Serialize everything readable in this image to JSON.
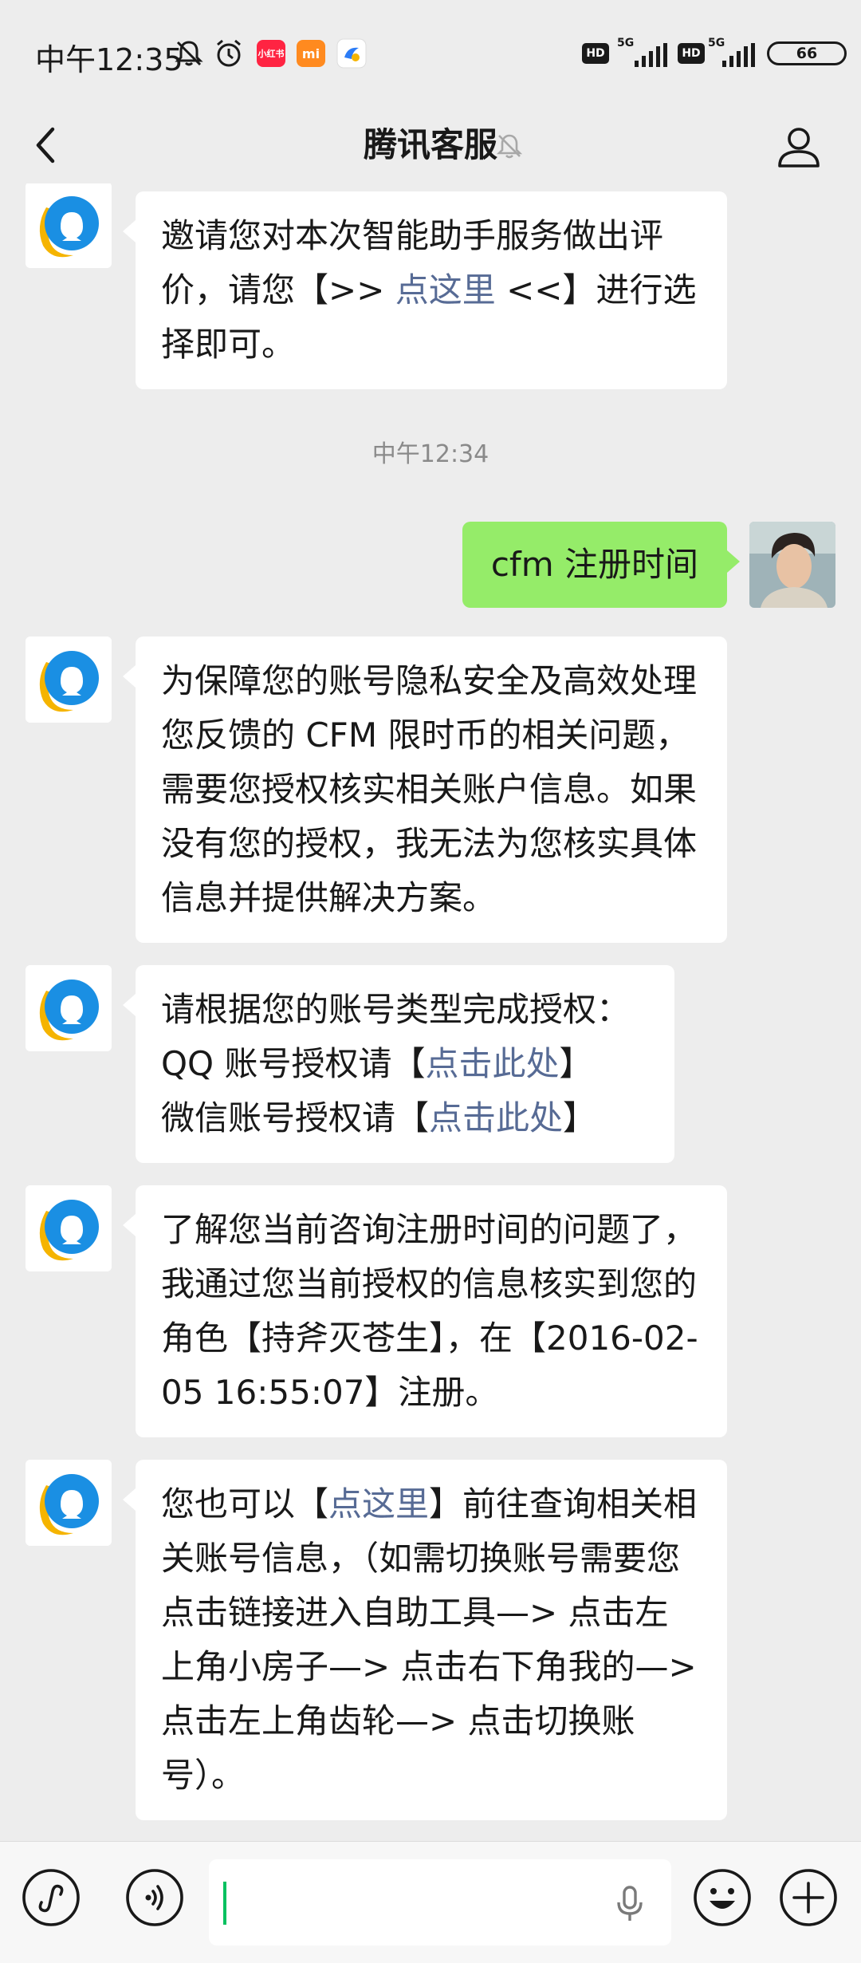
{
  "status_bar": {
    "time": "中午12:35",
    "app1": "小红书",
    "app2": "mi",
    "hd": "HD",
    "net1": "5G",
    "net2": "5G",
    "battery": "66"
  },
  "header": {
    "title": "腾讯客服"
  },
  "messages": [
    {
      "sender": "bot",
      "parts": [
        {
          "t": "邀请您对本次智能助手服务做出评价，请您【>> "
        },
        {
          "t": "点这里",
          "link": true
        },
        {
          "t": " <<】进行选择即可。"
        }
      ]
    },
    {
      "timestamp": "中午12:34"
    },
    {
      "sender": "user",
      "text": "cfm 注册时间"
    },
    {
      "sender": "bot",
      "parts": [
        {
          "t": "为保障您的账号隐私安全及高效处理您反馈的 CFM 限时币的相关问题，需要您授权核实相关账户信息。如果没有您的授权，我无法为您核实具体信息并提供解决方案。"
        }
      ]
    },
    {
      "sender": "bot",
      "lines": [
        [
          {
            "t": "请根据您的账号类型完成授权："
          }
        ],
        [
          {
            "t": "QQ 账号授权请【"
          },
          {
            "t": "点击此处",
            "link": true
          },
          {
            "t": "】"
          }
        ],
        [
          {
            "t": "微信账号授权请【"
          },
          {
            "t": "点击此处",
            "link": true
          },
          {
            "t": "】"
          }
        ]
      ]
    },
    {
      "sender": "bot",
      "parts": [
        {
          "t": "了解您当前咨询注册时间的问题了，我通过您当前授权的信息核实到您的角色【持斧灭苍生】，在【2016-02-05 16:55:07】注册。"
        }
      ]
    },
    {
      "sender": "bot",
      "parts": [
        {
          "t": "您也可以【"
        },
        {
          "t": "点这里",
          "link": true
        },
        {
          "t": "】前往查询相关相关账号信息，（如需切换账号需要您点击链接进入自助工具—> 点击左上角小房子—> 点击右下角我的—> 点击左上角齿轮—> 点击切换账号）。"
        }
      ]
    }
  ],
  "input": {
    "value": ""
  },
  "colors": {
    "background": "#ededed",
    "user_bubble": "#95ec69",
    "link": "#576b95",
    "caret": "#07c160"
  },
  "icons": [
    "back-arrow-icon",
    "mute-bell-icon",
    "profile-icon",
    "mini-program-icon",
    "voice-icon",
    "microphone-icon",
    "emoji-icon",
    "plus-icon"
  ]
}
